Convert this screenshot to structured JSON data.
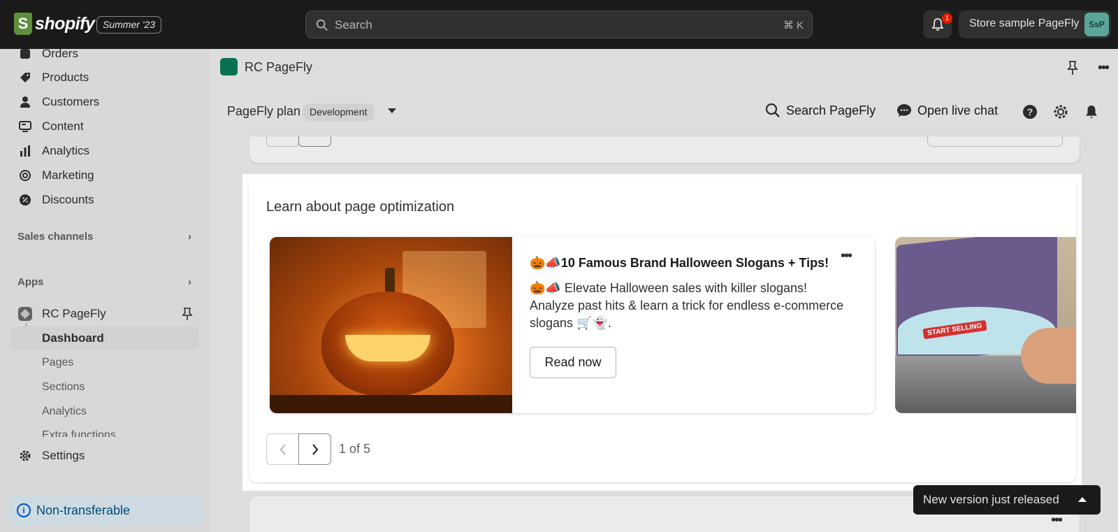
{
  "topbar": {
    "brand": "shopify",
    "edition_badge": "Summer '23",
    "search_placeholder": "Search",
    "search_shortcut": "⌘ K",
    "notifications_count": "1",
    "store_name": "Store sample PageFly",
    "avatar_initials": "SsP"
  },
  "sidebar": {
    "items": [
      {
        "label": "Orders",
        "icon": "orders-icon"
      },
      {
        "label": "Products",
        "icon": "tag-icon"
      },
      {
        "label": "Customers",
        "icon": "person-icon"
      },
      {
        "label": "Content",
        "icon": "content-icon"
      },
      {
        "label": "Analytics",
        "icon": "bar-chart-icon"
      },
      {
        "label": "Marketing",
        "icon": "target-icon"
      },
      {
        "label": "Discounts",
        "icon": "discount-icon"
      }
    ],
    "sales_channels": "Sales channels",
    "apps": "Apps",
    "app_name": "RC PageFly",
    "app_subitems": {
      "dashboard": "Dashboard",
      "pages": "Pages",
      "sections": "Sections",
      "analytics": "Analytics",
      "extra": "Extra functions"
    },
    "settings": "Settings",
    "non_transferable": "Non-transferable"
  },
  "app_header": {
    "title": "RC PageFly"
  },
  "pagefly_bar": {
    "plan_label": "PageFly plan",
    "plan_badge": "Development",
    "search_label": "Search PageFly",
    "chat_label": "Open live chat"
  },
  "learn": {
    "title": "Learn about page optimization",
    "article": {
      "title": "🎃📣10 Famous Brand Halloween Slogans + Tips!",
      "description": "🎃📣 Elevate Halloween sales with killer slogans! Analyze past hits & learn a trick for endless e-commerce slogans 🛒👻.",
      "button": "Read now"
    },
    "second_article_image_text": "START SELLING",
    "pager": {
      "count": "1 of 5"
    }
  },
  "toast": {
    "text": "New version just released"
  },
  "colors": {
    "topbar": "#1a1a1a",
    "sidebar": "#ebebeb",
    "accent_blue": "#005bd3",
    "notification_red": "#e51c00"
  }
}
